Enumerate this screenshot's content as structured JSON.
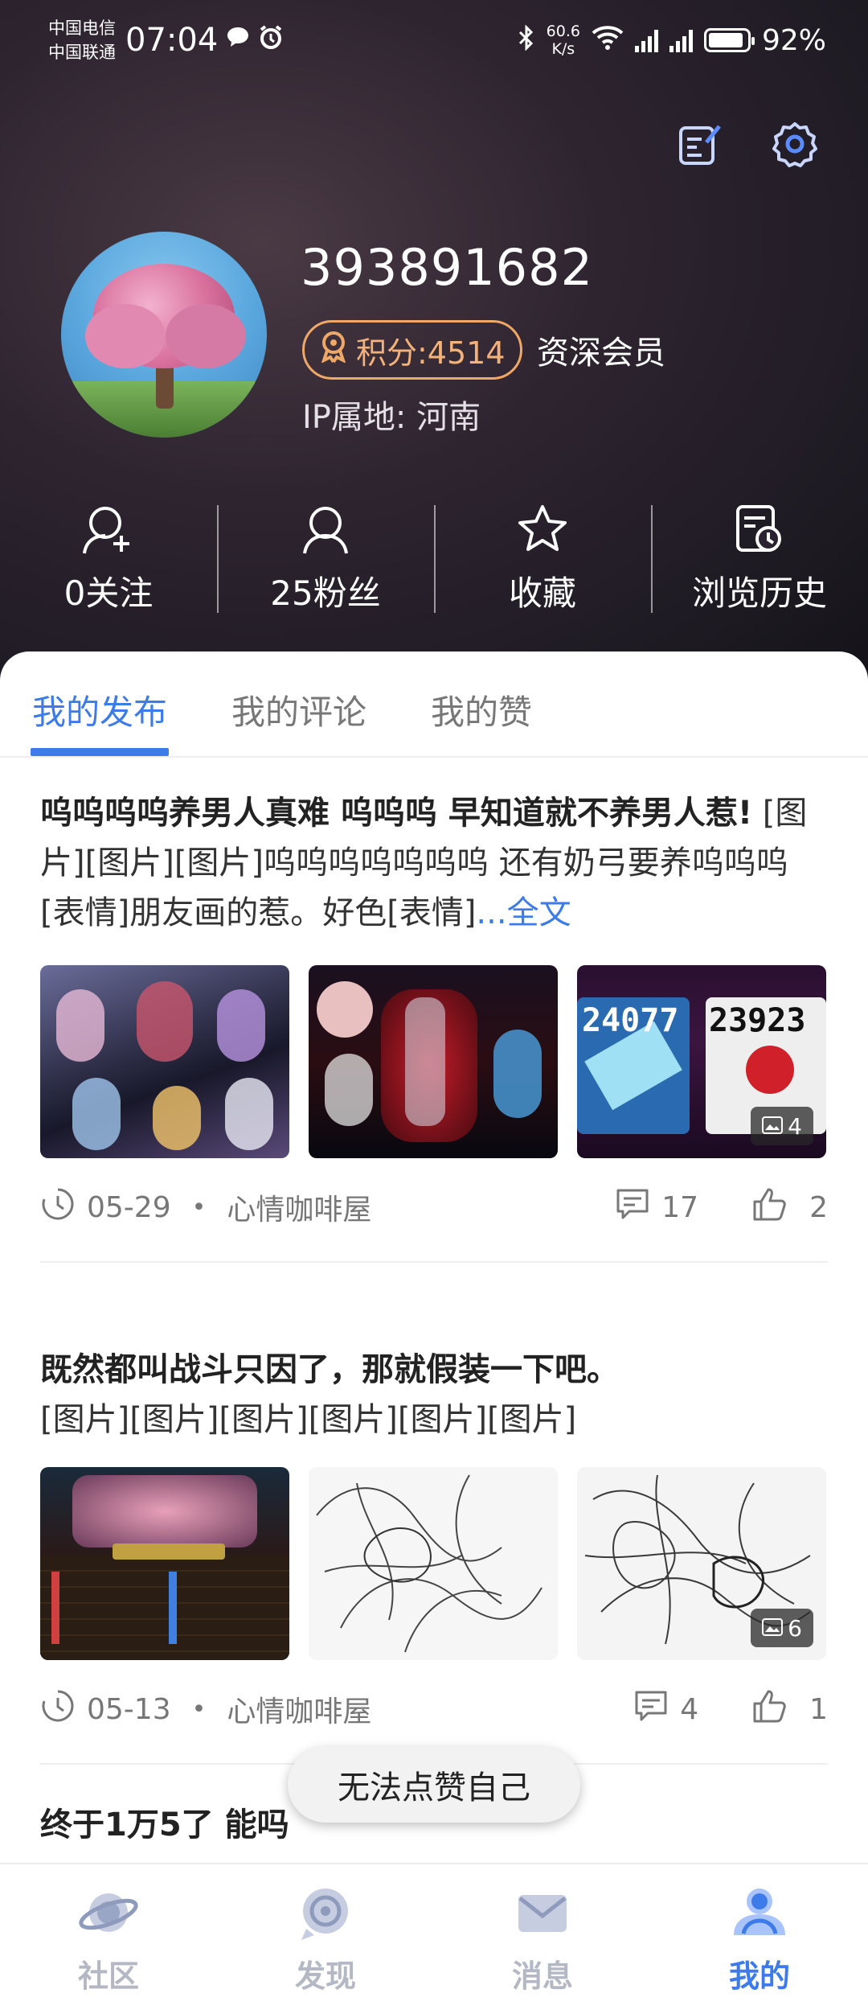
{
  "status_bar": {
    "carrier_1": "中国电信",
    "carrier_2": "中国联通",
    "time": "07:04",
    "speed_value": "60.6",
    "speed_unit": "K/s",
    "battery": "92%",
    "battery_level": 0.92
  },
  "profile": {
    "username": "393891682",
    "points": "积分:4514",
    "member_level": "资深会员",
    "ip_location": "IP属地: 河南"
  },
  "stats": [
    {
      "label": "0关注",
      "icon": "follow-icon"
    },
    {
      "label": "25粉丝",
      "icon": "fans-icon"
    },
    {
      "label": "收藏",
      "icon": "star-icon"
    },
    {
      "label": "浏览历史",
      "icon": "history-icon"
    }
  ],
  "tabs": [
    {
      "label": "我的发布",
      "active": true
    },
    {
      "label": "我的评论",
      "active": false
    },
    {
      "label": "我的赞",
      "active": false
    }
  ],
  "posts": [
    {
      "title": "呜呜呜呜养男人真难  呜呜呜  早知道就不养男人惹!",
      "body": "  [图片][图片][图片]呜呜呜呜呜呜呜 还有奶弓要养呜呜呜[表情]朋友画的惹。好色[表情]",
      "more": "...全文",
      "image_count": "4",
      "date": "05-29",
      "board": "心情咖啡屋",
      "comments": "17",
      "likes": "2"
    },
    {
      "title": "既然都叫战斗只因了，那就假装一下吧。",
      "body": "[图片][图片][图片][图片][图片][图片]",
      "image_count": "6",
      "date": "05-13",
      "board": "心情咖啡屋",
      "comments": "4",
      "likes": "1"
    },
    {
      "title": "终于1万5了 能吗"
    }
  ],
  "toast": "无法点赞自己",
  "bottom_nav": [
    {
      "label": "社区",
      "icon": "planet-icon"
    },
    {
      "label": "发现",
      "icon": "discover-icon"
    },
    {
      "label": "消息",
      "icon": "mail-icon"
    },
    {
      "label": "我的",
      "icon": "user-icon",
      "active": true
    }
  ],
  "colors": {
    "accent": "#3d7bea",
    "points": "#f0a866"
  }
}
